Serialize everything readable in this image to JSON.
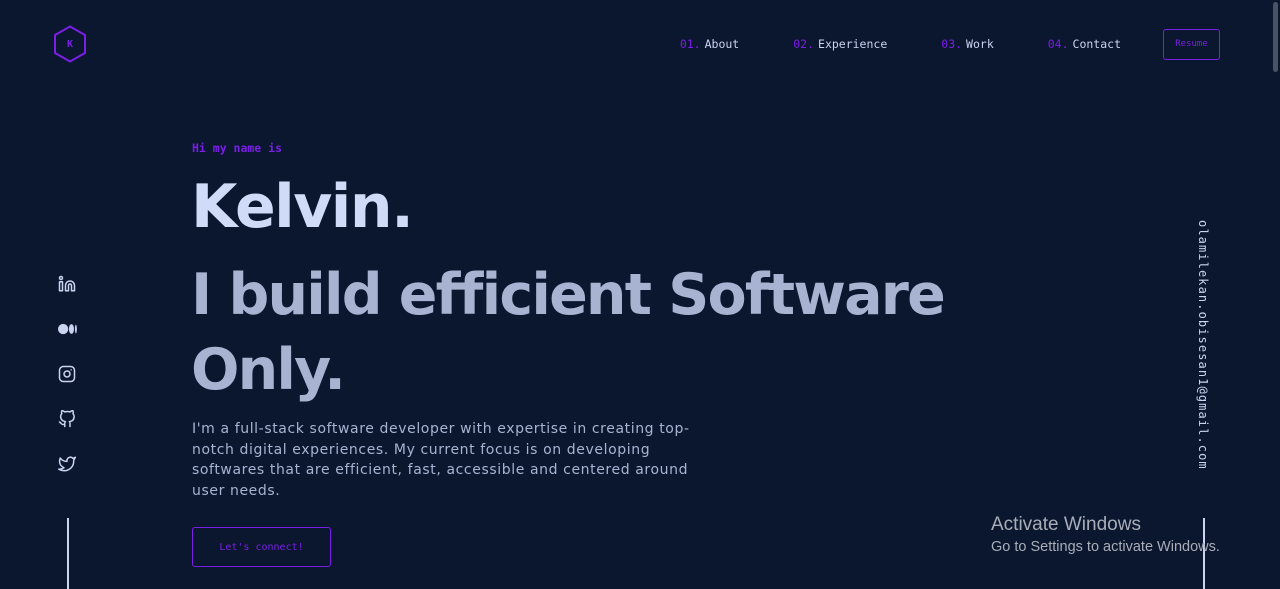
{
  "logo": {
    "letter": "K"
  },
  "nav": {
    "items": [
      {
        "num": "01.",
        "label": "About"
      },
      {
        "num": "02.",
        "label": "Experience"
      },
      {
        "num": "03.",
        "label": "Work"
      },
      {
        "num": "04.",
        "label": "Contact"
      }
    ],
    "resume_label": "Resume"
  },
  "social": {
    "icons": [
      "linkedin-icon",
      "medium-icon",
      "instagram-icon",
      "github-icon",
      "twitter-icon"
    ]
  },
  "email": "olamilekan.obisesan1@gmail.com",
  "hero": {
    "intro": "Hi my name is",
    "name": "Kelvin.",
    "tagline": "I build efficient Software Only.",
    "description": "I'm a full-stack software developer with expertise in creating top-notch digital experiences. My current focus is on developing softwares that are efficient, fast, accessible and centered around user needs.",
    "cta_label": "Let's connect!"
  },
  "windows_watermark": {
    "title": "Activate Windows",
    "subtitle": "Go to Settings to activate Windows."
  },
  "colors": {
    "background": "#0b172f",
    "accent": "#7a1fe6",
    "heading": "#d0dbf8",
    "text": "#a8b3d2",
    "nav_text": "#cad3f0"
  }
}
